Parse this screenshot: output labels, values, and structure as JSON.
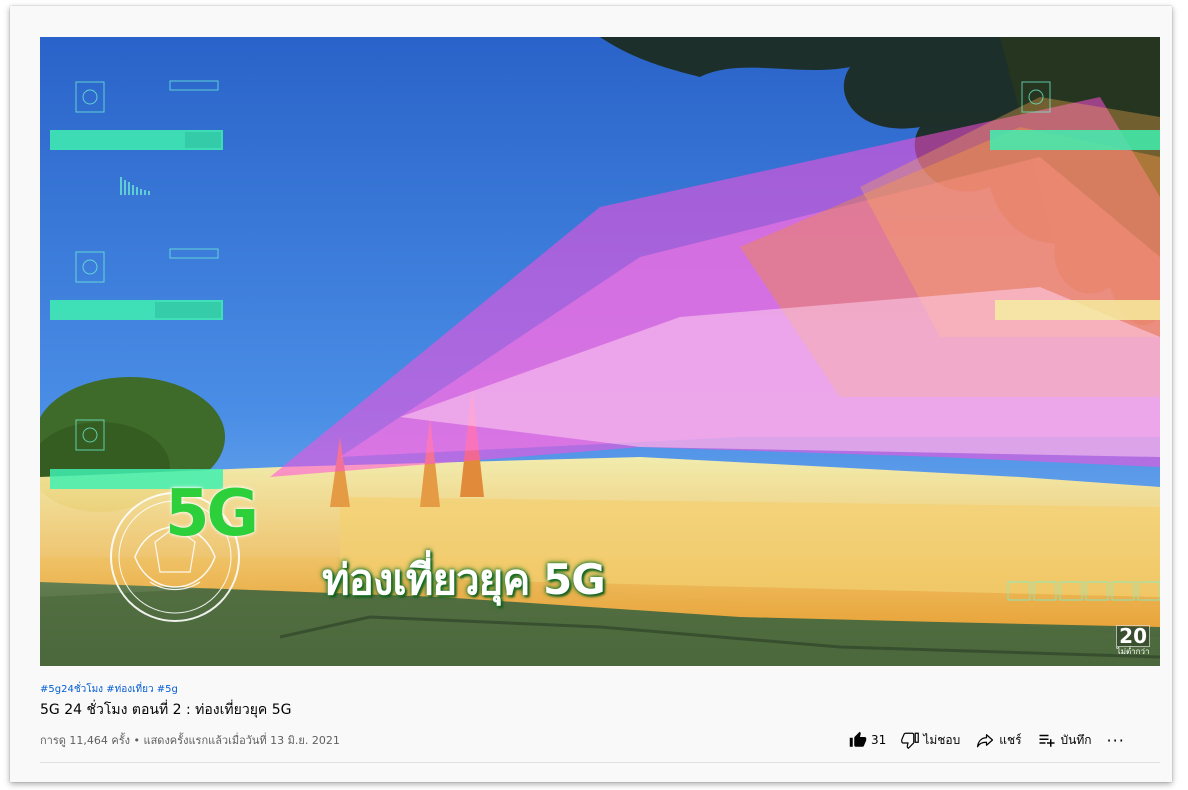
{
  "video": {
    "overlay_5g": "5G",
    "overlay_title": "ท่องเที่ยวยุค 5G",
    "rating_number": "20",
    "rating_sub": "ไม่ต่ำกว่า"
  },
  "info": {
    "hashtags": "#5g24ชั่วโมง #ท่องเที่ยว #5g",
    "title": "5G 24 ชั่วโมง ตอนที่ 2 : ท่องเที่ยวยุค 5G",
    "meta": "การดู 11,464 ครั้ง • แสดงครั้งแรกแล้วเมื่อวันที่ 13 มิ.ย. 2021"
  },
  "actions": {
    "like_count": "31",
    "dislike_label": "ไม่ชอบ",
    "share_label": "แชร์",
    "save_label": "บันทึก",
    "more_label": "···"
  },
  "icons": {
    "like": "thumbs-up-icon",
    "dislike": "thumbs-down-icon",
    "share": "share-arrow-icon",
    "save": "playlist-add-icon"
  },
  "colors": {
    "link": "#065fd4",
    "text": "#030303",
    "muted": "#606060",
    "overlay_green": "#2dcf3a"
  }
}
